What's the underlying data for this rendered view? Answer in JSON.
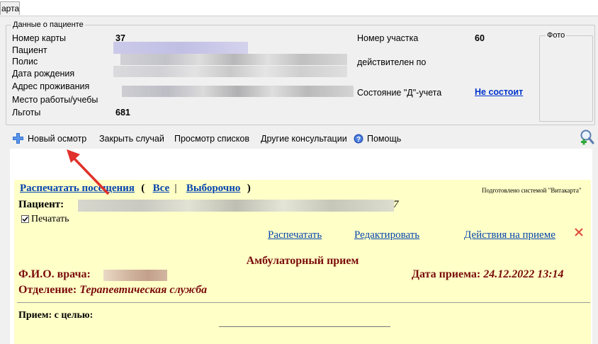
{
  "window": {
    "tab_label": "арта"
  },
  "patient_panel": {
    "legend": "Данные о пациенте",
    "card_number_label": "Номер карты",
    "card_number_value": "37",
    "patient_label": "Пациент",
    "policy_label": "Полис",
    "birth_date_label": "Дата рождения",
    "address_label": "Адрес проживания",
    "work_label": "Место работы/учебы",
    "benefits_label": "Льготы",
    "benefits_value": "681",
    "district_label": "Номер участка",
    "district_value": "60",
    "valid_until_label": "действителен по",
    "d_status_label": "Состояние \"Д\"-учета",
    "d_status_value": "Не состоит",
    "photo_legend": "Фото"
  },
  "toolbar": {
    "new_exam": "Новый осмотр",
    "close_case": "Закрыть случай",
    "view_lists": "Просмотр списков",
    "other_consultations": "Другие консультации",
    "help": "Помощь"
  },
  "document": {
    "print_visits": "Распечатать посещения",
    "paren_open": "(",
    "all": "Все",
    "separator": "|",
    "selective": "Выборочно",
    "paren_close": ")",
    "prepared_by": "Подготовлено системой \"Витакарта\"",
    "patient_label": "Пациент:",
    "patient_tail": "7",
    "print_checkbox_label": "Печатать",
    "print_checked": true,
    "action_print": "Распечатать",
    "action_edit": "Редактировать",
    "action_actions": "Действия на приеме",
    "heading": "Амбулаторный прием",
    "doctor_label": "Ф.И.О. врача:",
    "doctor_tail": "ИИ",
    "date_label": "Дата приема:",
    "date_value": "24.12.2022 13:14",
    "department_label": "Отделение:",
    "department_value": "Терапевтическая служба",
    "purpose_label": "Прием: с целью:"
  },
  "colors": {
    "doc_background": "#ffffc8",
    "maroon": "#7a0b0b",
    "link_blue": "#0645ad",
    "arrow_red": "#e0312a"
  }
}
